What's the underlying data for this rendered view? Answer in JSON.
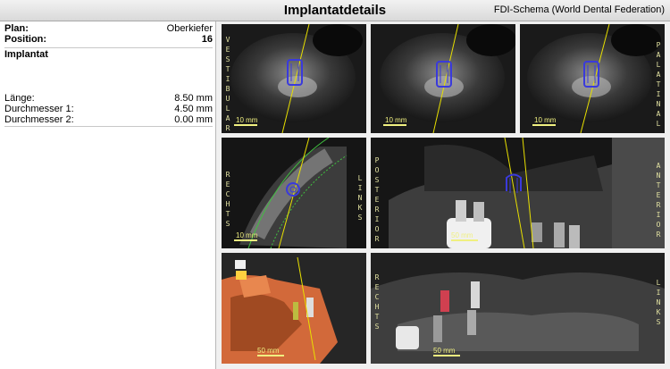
{
  "header": {
    "title": "Implantatdetails",
    "schema": "FDI-Schema (World Dental Federation)"
  },
  "info": {
    "plan_label": "Plan:",
    "plan_value": "Oberkiefer",
    "position_label": "Position:",
    "position_value": "16",
    "section_title": "Implantat",
    "length_label": "Länge:",
    "length_value": "8.50 mm",
    "d1_label": "Durchmesser 1:",
    "d1_value": "4.50 mm",
    "d2_label": "Durchmesser 2:",
    "d2_value": "0.00 mm"
  },
  "panels": {
    "p1": {
      "left_label": "VESTIBULAR",
      "scale": "10 mm"
    },
    "p2": {
      "scale": "10 mm"
    },
    "p3": {
      "right_label": "PALATINAL",
      "scale": "10 mm"
    },
    "p4": {
      "left_label": "RECHTS",
      "right_label": "LINKS",
      "scale": "10 mm"
    },
    "p5": {
      "left_label": "POSTERIOR",
      "right_label": "ANTERIOR",
      "scale": "50 mm"
    },
    "p6": {
      "scale": "50 mm"
    },
    "p7": {
      "left_label": "RECHTS",
      "right_label": "LINKS",
      "scale": "50 mm"
    }
  },
  "colors": {
    "guide_line": "#e8e000",
    "implant": "#3a3adc",
    "arch_curve": "#40c040",
    "bone_3d": "#d2693a"
  }
}
